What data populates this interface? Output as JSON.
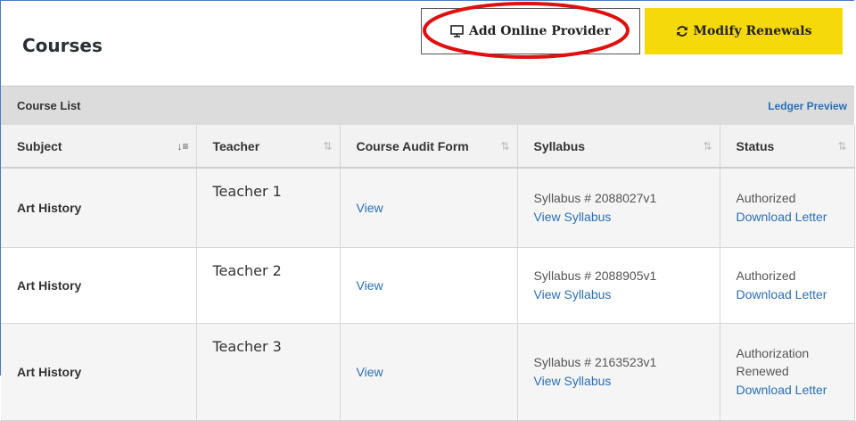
{
  "header": {
    "title": "Courses",
    "add_provider_label": "Add Online Provider",
    "modify_renewals_label": "Modify Renewals"
  },
  "course_list": {
    "title": "Course List",
    "ledger_preview_label": "Ledger Preview"
  },
  "table": {
    "columns": [
      "Subject",
      "Teacher",
      "Course Audit Form",
      "Syllabus",
      "Status"
    ],
    "rows": [
      {
        "subject": "Art History",
        "teacher": "Teacher 1",
        "audit_link": "View",
        "syllabus_number": "Syllabus # 2088027v1",
        "syllabus_link": "View Syllabus",
        "status": "Authorized",
        "status_line2": "",
        "status_link": "Download Letter"
      },
      {
        "subject": "Art History",
        "teacher": "Teacher 2",
        "audit_link": "View",
        "syllabus_number": "Syllabus # 2088905v1",
        "syllabus_link": "View Syllabus",
        "status": "Authorized",
        "status_line2": "",
        "status_link": "Download Letter"
      },
      {
        "subject": "Art History",
        "teacher": "Teacher 3",
        "audit_link": "View",
        "syllabus_number": "Syllabus # 2163523v1",
        "syllabus_link": "View Syllabus",
        "status": "Authorization",
        "status_line2": "Renewed",
        "status_link": "Download Letter"
      }
    ]
  },
  "icons": {
    "add_provider": "monitor-icon",
    "modify_renewals": "refresh-icon",
    "sort": "sort-icon"
  },
  "colors": {
    "accent_yellow": "#f5d90a",
    "link_blue": "#2a6fb8",
    "annotation_red": "#e01010"
  }
}
